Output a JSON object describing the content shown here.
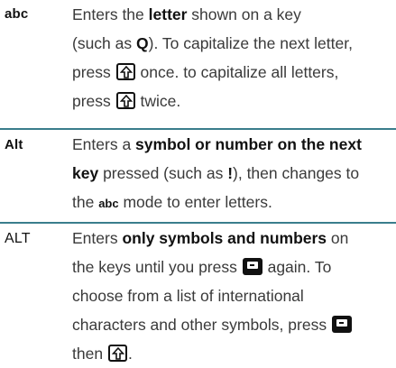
{
  "rows": [
    {
      "mode": "abc",
      "text": {
        "l1a": "Enters the ",
        "l1b": "letter",
        "l1c": " shown on a key",
        "l2a": "(such as ",
        "l2b": "Q",
        "l2c": "). To capitalize the next letter,",
        "l3a": "press ",
        "l3b": " once. to capitalize all letters,",
        "l4a": "press ",
        "l4b": " twice."
      }
    },
    {
      "mode": "Alt",
      "text": {
        "l1a": "Enters a ",
        "l1b": "symbol or number on the next",
        "l2a": "key",
        "l2b": " pressed (such as ",
        "l2c": "!",
        "l2d": "), then changes to",
        "l3a": "the ",
        "l3b": "abc",
        "l3c": " mode to enter letters."
      }
    },
    {
      "mode": "ALT",
      "text": {
        "l1a": "Enters ",
        "l1b": "only symbols and numbers",
        "l1c": " on",
        "l2a": "the keys until you press ",
        "l2b": " again. To",
        "l3a": "choose from a list of international",
        "l4a": "characters and other symbols, press ",
        "l5a": "then ",
        "l5b": "."
      }
    }
  ],
  "icons": {
    "shift_key": "shift-up-arrow-key",
    "alt_key": "alt-function-key"
  },
  "colors": {
    "divider": "#3a7d8c",
    "text": "#3a3a3a",
    "emphasis": "#111111"
  }
}
